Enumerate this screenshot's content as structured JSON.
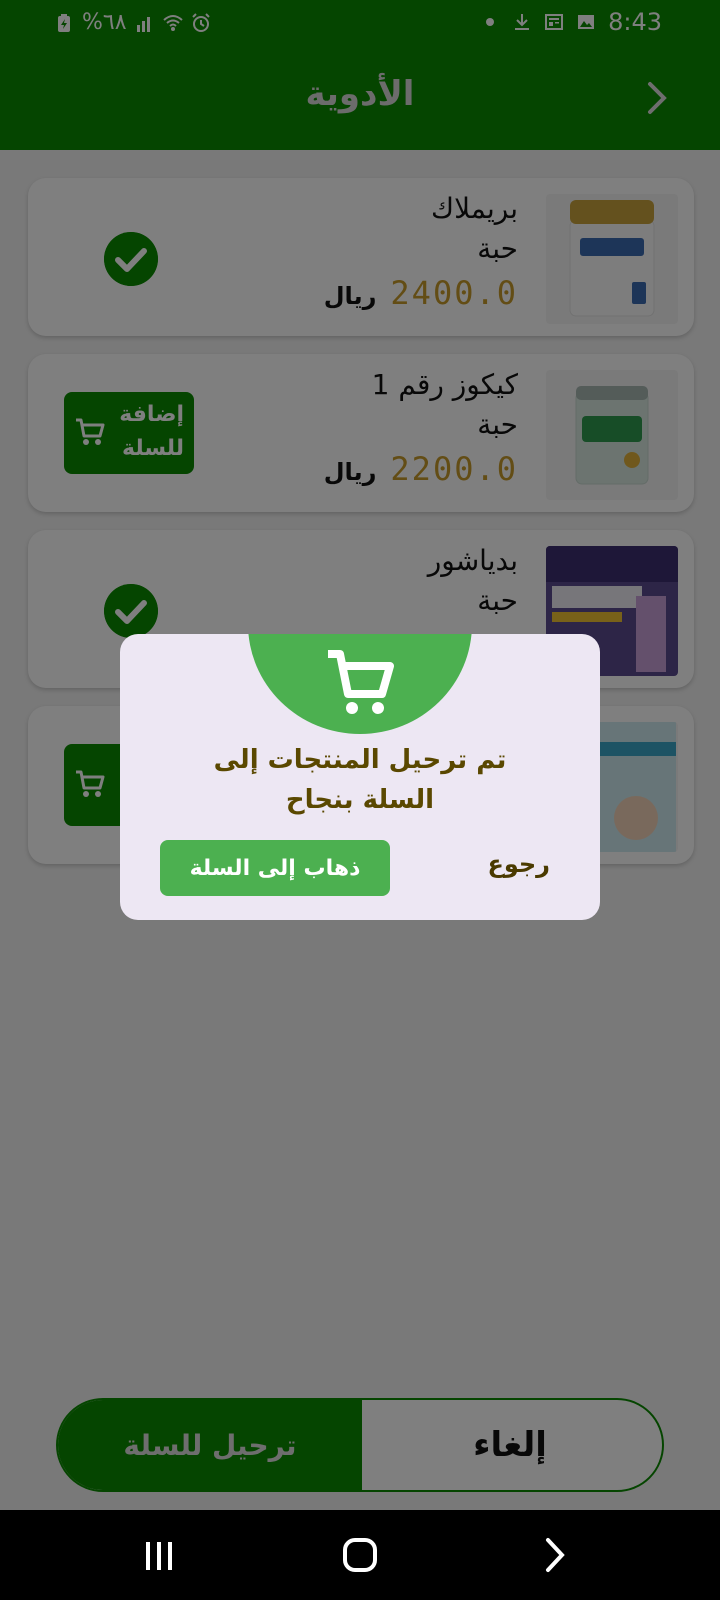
{
  "status_bar": {
    "battery_text": "%٦٨",
    "time": "8:43",
    "icons": [
      "battery-icon",
      "signal-icon",
      "wifi-icon",
      "alarm-icon",
      "dot-icon",
      "download-icon",
      "news-icon",
      "gallery-icon"
    ]
  },
  "header": {
    "title": "الأدوية",
    "back_icon": "chevron-right-icon"
  },
  "products": [
    {
      "name": "بريملاك",
      "unit": "حبة",
      "price": "2400.0",
      "currency": "ريال",
      "in_cart": true
    },
    {
      "name": "كيكوز رقم 1",
      "unit": "حبة",
      "price": "2200.0",
      "currency": "ريال",
      "in_cart": false,
      "add_label_line1": "إضافة",
      "add_label_line2": "للسلة"
    },
    {
      "name": "بدياشور",
      "unit": "حبة",
      "in_cart": true
    },
    {
      "in_cart": false
    }
  ],
  "dialog": {
    "message_line1": "تم ترحيل المنتجات إلى",
    "message_line2": "السلة بنجاح",
    "go_to_cart": "ذهاب إلى السلة",
    "back": "رجوع"
  },
  "bottom": {
    "submit": "ترحيل للسلة",
    "cancel": "إلغاء"
  },
  "colors": {
    "primary": "#0a8a00",
    "dialog_green": "#4cb050",
    "price": "#c79a2a"
  }
}
